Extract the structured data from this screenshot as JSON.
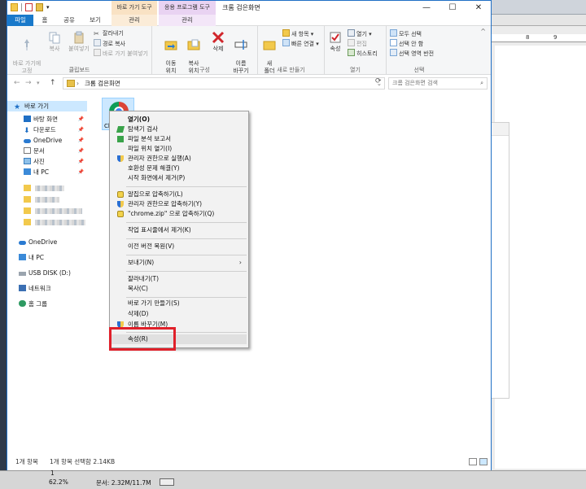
{
  "window": {
    "title": "크롬 검은화면",
    "context_tab_shortcut": "바로 가기 도구",
    "context_tab_app": "응용 프로그램 도구",
    "minimize": "—",
    "maximize": "☐",
    "close": "✕"
  },
  "tabs": {
    "file": "파일",
    "home": "홈",
    "share": "공유",
    "view": "보기",
    "manage1": "관리",
    "manage2": "관리"
  },
  "ribbon": {
    "clipboard": {
      "pin": "바로 가기에\n고정",
      "copy": "복사",
      "paste": "붙여넣기",
      "cut": "잘라내기",
      "copy_path": "경로 복사",
      "paste_shortcut": "바로 가기 붙여넣기",
      "label": "클립보드"
    },
    "organize": {
      "move_to": "이동\n위치",
      "copy_to": "복사\n위치",
      "delete": "삭제",
      "rename": "이름\n바꾸기",
      "label": "구성"
    },
    "new": {
      "new_folder": "새\n폴더",
      "new_item": "새 항목",
      "easy_access": "빠른 연결",
      "label": "새로 만들기"
    },
    "open": {
      "properties": "속성",
      "open": "열기",
      "edit": "편집",
      "history": "히스토리",
      "label": "열기"
    },
    "select": {
      "select_all": "모두 선택",
      "select_none": "선택 안 함",
      "invert": "선택 영역 반전",
      "label": "선택"
    }
  },
  "address": {
    "path": "크롬 검은화면",
    "search_placeholder": "크롬 검은화면 검색"
  },
  "sidebar": {
    "quick_access": "바로 가기",
    "items": [
      {
        "label": "바탕 화면"
      },
      {
        "label": "다운로드"
      },
      {
        "label": "OneDrive"
      },
      {
        "label": "문서"
      },
      {
        "label": "사진"
      },
      {
        "label": "내 PC"
      }
    ],
    "onedrive": "OneDrive",
    "this_pc": "내 PC",
    "usb": "USB DISK (D:)",
    "network": "네트워크",
    "homegroup": "홈 그룹"
  },
  "file": {
    "name": "Chro"
  },
  "context_menu": {
    "items": [
      {
        "label": "열기(O)"
      },
      {
        "label": "탐색기 검사"
      },
      {
        "label": "파일 분석 보고서"
      },
      {
        "label": "파일 위치 열기(I)"
      },
      {
        "label": "관리자 권한으로 실행(A)"
      },
      {
        "label": "호환성 문제 해결(Y)"
      },
      {
        "label": "시작 화면에서 제거(P)"
      },
      {
        "label": "알집으로 압축하기(L)"
      },
      {
        "label": "관리자 권한으로 압축하기(Y)"
      },
      {
        "label": "\"chrome.zip\" 으로 압축하기(Q)"
      },
      {
        "label": "작업 표시줄에서 제거(K)"
      },
      {
        "label": "이전 버전 복원(V)"
      },
      {
        "label": "보내기(N)"
      },
      {
        "label": "잘라내기(T)"
      },
      {
        "label": "복사(C)"
      },
      {
        "label": "바로 가기 만들기(S)"
      },
      {
        "label": "삭제(D)"
      },
      {
        "label": "이름 바꾸기(M)"
      },
      {
        "label": "속성(R)"
      }
    ]
  },
  "status": {
    "count": "1개 항목",
    "selected": "1개 항목 선택함 2.14KB"
  },
  "bottom_app": {
    "page": "1",
    "zoom": "62.2%",
    "position": "문서: 2.32M/11.7M"
  },
  "ruler": {
    "mark1": "8",
    "mark2": "9"
  },
  "colors": {
    "accent": "#1979ca",
    "highlight": "#e0202a"
  }
}
